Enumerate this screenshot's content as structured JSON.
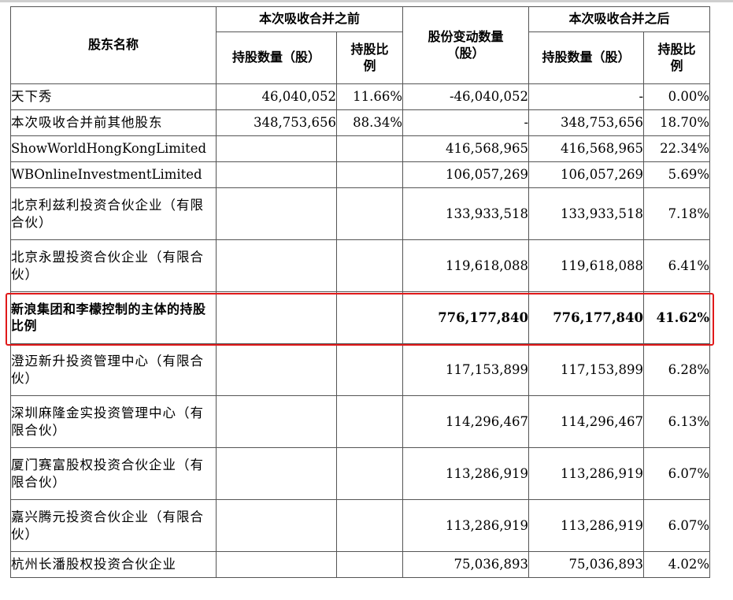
{
  "headers": {
    "name": "股东名称",
    "before_group": "本次吸收合并之前",
    "change": "股份变动数量（股）",
    "after_group": "本次吸收合并之后",
    "shares": "持股数量（股）",
    "ratio": "持股比例"
  },
  "rows": [
    {
      "name": "天下秀",
      "before_shares": "46,040,052",
      "before_ratio": "11.66%",
      "change": "-46,040,052",
      "after_shares": "-",
      "after_ratio": "0.00%"
    },
    {
      "name": "本次吸收合并前其他股东",
      "before_shares": "348,753,656",
      "before_ratio": "88.34%",
      "change": "-",
      "after_shares": "348,753,656",
      "after_ratio": "18.70%"
    },
    {
      "name": "ShowWorldHongKongLimited",
      "before_shares": "",
      "before_ratio": "",
      "change": "416,568,965",
      "after_shares": "416,568,965",
      "after_ratio": "22.34%"
    },
    {
      "name": "WBOnlineInvestmentLimited",
      "before_shares": "",
      "before_ratio": "",
      "change": "106,057,269",
      "after_shares": "106,057,269",
      "after_ratio": "5.69%"
    },
    {
      "name": "北京利兹利投资合伙企业（有限合伙）",
      "before_shares": "",
      "before_ratio": "",
      "change": "133,933,518",
      "after_shares": "133,933,518",
      "after_ratio": "7.18%"
    },
    {
      "name": "北京永盟投资合伙企业（有限合伙）",
      "before_shares": "",
      "before_ratio": "",
      "change": "119,618,088",
      "after_shares": "119,618,088",
      "after_ratio": "6.41%"
    },
    {
      "name": "新浪集团和李檬控制的主体的持股比例",
      "before_shares": "",
      "before_ratio": "",
      "change": "776,177,840",
      "after_shares": "776,177,840",
      "after_ratio": "41.62%"
    },
    {
      "name": "澄迈新升投资管理中心（有限合伙）",
      "before_shares": "",
      "before_ratio": "",
      "change": "117,153,899",
      "after_shares": "117,153,899",
      "after_ratio": "6.28%"
    },
    {
      "name": "深圳麻隆金实投资管理中心（有限合伙）",
      "before_shares": "",
      "before_ratio": "",
      "change": "114,296,467",
      "after_shares": "114,296,467",
      "after_ratio": "6.13%"
    },
    {
      "name": "厦门赛富股权投资合伙企业（有限合伙）",
      "before_shares": "",
      "before_ratio": "",
      "change": "113,286,919",
      "after_shares": "113,286,919",
      "after_ratio": "6.07%"
    },
    {
      "name": "嘉兴腾元投资合伙企业（有限合伙）",
      "before_shares": "",
      "before_ratio": "",
      "change": "113,286,919",
      "after_shares": "113,286,919",
      "after_ratio": "6.07%"
    },
    {
      "name": "杭州长潘股权投资合伙企业",
      "before_shares": "",
      "before_ratio": "",
      "change": "75,036,893",
      "after_shares": "75,036,893",
      "after_ratio": "4.02%"
    }
  ],
  "highlight_color": "#e0191a"
}
